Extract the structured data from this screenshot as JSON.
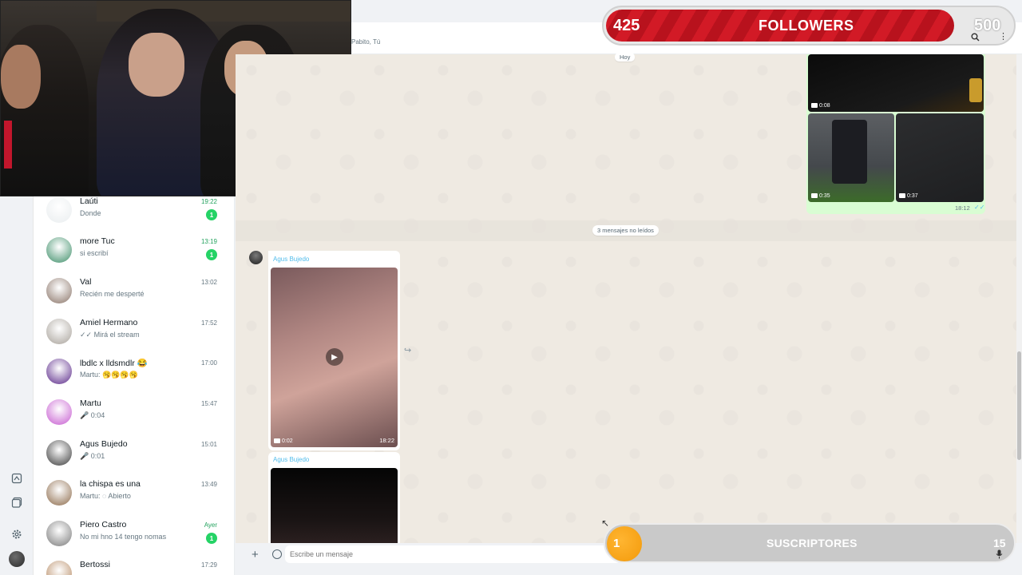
{
  "chat": {
    "members": "Pabito, Tú",
    "date_divider": "Hoy",
    "unread_divider": "3 mensajes no leídos",
    "outgoing": {
      "videos": [
        {
          "duration": "0:08"
        },
        {
          "duration": "0:35"
        },
        {
          "duration": "0:37"
        }
      ],
      "time": "18:12",
      "ticks": "✓✓"
    },
    "incoming": [
      {
        "sender": "Agus Bujedo",
        "duration": "0:02",
        "time": "18:22"
      },
      {
        "sender": "Agus Bujedo"
      }
    ],
    "composer_placeholder": "Escribe un mensaje"
  },
  "sidebar": {
    "chats": [
      {
        "name": "Laúti",
        "preview": "Donde",
        "time": "19:22",
        "unread": "1",
        "avatar_color": "#e9edef"
      },
      {
        "name": "more Tuc",
        "preview": "si escribí",
        "time": "13:19",
        "unread": "1",
        "avatar_color": "#3f8f6a"
      },
      {
        "name": "Val",
        "preview": "Recién me desperté",
        "time": "13:02",
        "unread": "",
        "avatar_color": "#8a7468"
      },
      {
        "name": "Amiel Hermano",
        "preview": "✓✓ Mirá el stream",
        "time": "17:52",
        "unread": "",
        "avatar_color": "#a8a29a"
      },
      {
        "name": "lbdlc x lldsmdlr 😂",
        "preview": "Martu: 🥱🥱🥱🥱",
        "time": "17:00",
        "unread": "",
        "avatar_color": "#5b2a8a"
      },
      {
        "name": "Martu",
        "preview": "🎤 0:04",
        "time": "15:47",
        "unread": "",
        "avatar_color": "#c65bd0"
      },
      {
        "name": "Agus Bujedo",
        "preview": "🎤 0:01",
        "time": "15:01",
        "unread": "",
        "avatar_color": "#3a3a3a"
      },
      {
        "name": "la chispa es una",
        "preview": "Martu: ◌ Abierto",
        "time": "13:49",
        "unread": "",
        "avatar_color": "#8c6a4a"
      },
      {
        "name": "Piero Castro",
        "preview": "No mi hno 14 tengo nomas",
        "time": "Ayer",
        "unread": "1",
        "avatar_color": "#7a7a7a"
      },
      {
        "name": "Bertossi",
        "preview": "",
        "time": "17:29",
        "unread": "",
        "avatar_color": "#b58860"
      }
    ]
  },
  "overlay": {
    "followers": {
      "current": "425",
      "label": "FOLLOWERS",
      "goal": "500",
      "progress": 0.85,
      "color": "#d21a26"
    },
    "subscribers": {
      "current": "1",
      "label": "SUSCRIPTORES",
      "goal": "15",
      "progress": 0.067,
      "color": "#f5a623"
    }
  }
}
